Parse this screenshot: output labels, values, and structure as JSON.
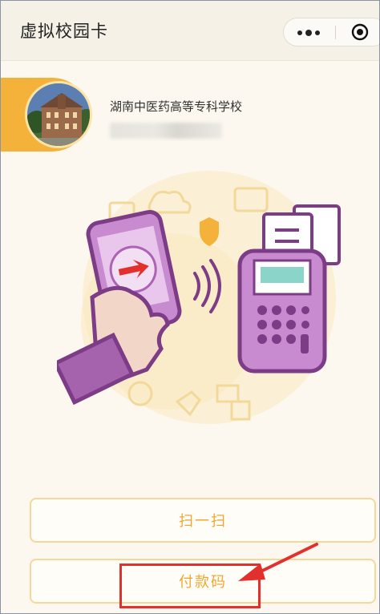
{
  "header": {
    "title": "虚拟校园卡",
    "menu_icon": "more-dots-icon",
    "close_icon": "target-close-icon"
  },
  "card": {
    "school_name": "湖南中医药高等专科学校",
    "account_masked": "",
    "avatar": "campus-building-photo"
  },
  "illustration": {
    "name": "phone-payment-illustration",
    "accent": "#9b4fa8",
    "fill": "#fbecc2"
  },
  "actions": {
    "scan_label": "扫一扫",
    "pay_label": "付款码"
  },
  "colors": {
    "accent": "#f4b23a",
    "button_text": "#f0a732",
    "highlight": "#e2312c"
  }
}
